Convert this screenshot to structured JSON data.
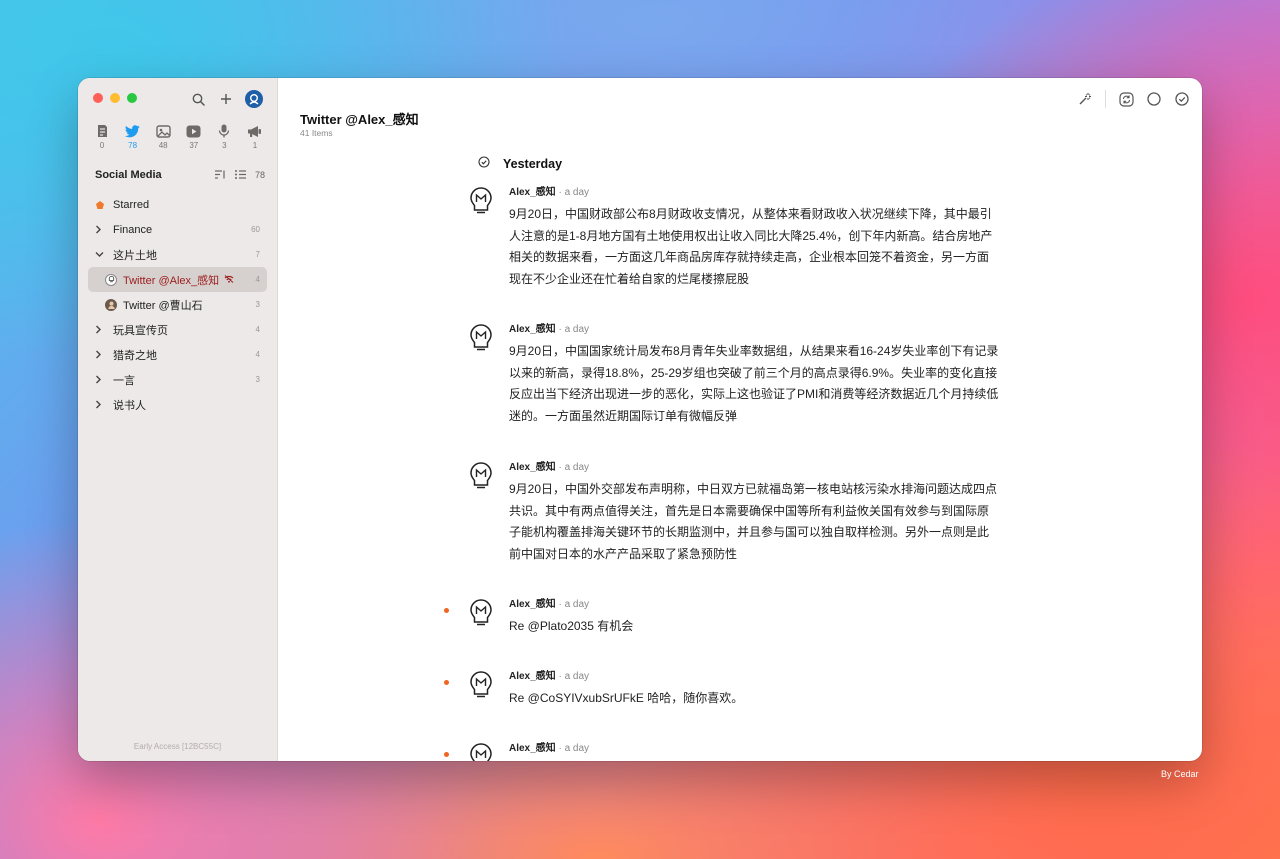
{
  "sidebar": {
    "feed_types": [
      {
        "icon": "article-icon",
        "count": "0"
      },
      {
        "icon": "twitter-icon",
        "count": "78"
      },
      {
        "icon": "image-icon",
        "count": "48"
      },
      {
        "icon": "video-icon",
        "count": "37"
      },
      {
        "icon": "podcast-icon",
        "count": "3"
      },
      {
        "icon": "announcement-icon",
        "count": "1"
      }
    ],
    "section_title": "Social Media",
    "section_count": "78",
    "nav": [
      {
        "label": "Starred",
        "count": ""
      },
      {
        "label": "Finance",
        "count": "60"
      },
      {
        "label": "这片土地",
        "count": "7"
      },
      {
        "label": "Twitter @Alex_感知",
        "count": "4"
      },
      {
        "label": "Twitter @曹山石",
        "count": "3"
      },
      {
        "label": "玩具宣传页",
        "count": "4"
      },
      {
        "label": "猎奇之地",
        "count": "4"
      },
      {
        "label": "一言",
        "count": "3"
      },
      {
        "label": "说书人",
        "count": ""
      }
    ],
    "footer": "Early Access [12BC55C]"
  },
  "main": {
    "title": "Twitter @Alex_感知",
    "count_label": "41 Items",
    "day_label": "Yesterday",
    "items": [
      {
        "author": "Alex_感知",
        "time": " · a day",
        "unread": false,
        "text": "9月20日，中国财政部公布8月财政收支情况，从整体来看财政收入状况继续下降，其中最引人注意的是1-8月地方国有土地使用权出让收入同比大降25.4%，创下年内新高。结合房地产相关的数据来看，一方面这几年商品房库存就持续走高，企业根本回笼不着资金，另一方面现在不少企业还在忙着给自家的烂尾楼擦屁股"
      },
      {
        "author": "Alex_感知",
        "time": " · a day",
        "unread": false,
        "text": "9月20日，中国国家统计局发布8月青年失业率数据组，从结果来看16-24岁失业率创下有记录以来的新高，录得18.8%，25-29岁组也突破了前三个月的高点录得6.9%。失业率的变化直接反应出当下经济出现进一步的恶化，实际上这也验证了PMI和消费等经济数据近几个月持续低迷的。一方面虽然近期国际订单有微幅反弹"
      },
      {
        "author": "Alex_感知",
        "time": " · a day",
        "unread": false,
        "text": "9月20日，中国外交部发布声明称，中日双方已就福岛第一核电站核污染水排海问题达成四点共识。其中有两点值得关注，首先是日本需要确保中国等所有利益攸关国有效参与到国际原子能机构覆盖排海关键环节的长期监测中，并且参与国可以独自取样检测。另外一点则是此前中国对日本的水产产品采取了紧急预防性"
      },
      {
        "author": "Alex_感知",
        "time": " · a day",
        "unread": true,
        "text": "Re @Plato2035 有机会"
      },
      {
        "author": "Alex_感知",
        "time": " · a day",
        "unread": true,
        "text": "Re @CoSYIVxubSrUFkE 哈哈，随你喜欢。"
      },
      {
        "author": "Alex_感知",
        "time": " · a day",
        "unread": true,
        "text": ""
      }
    ]
  },
  "credit": "By Cedar",
  "colors": {
    "accent": "#1d9bf0",
    "selected_text": "#9b1c1c",
    "unread_dot": "#f0651f",
    "starred": "#f07a2a"
  }
}
